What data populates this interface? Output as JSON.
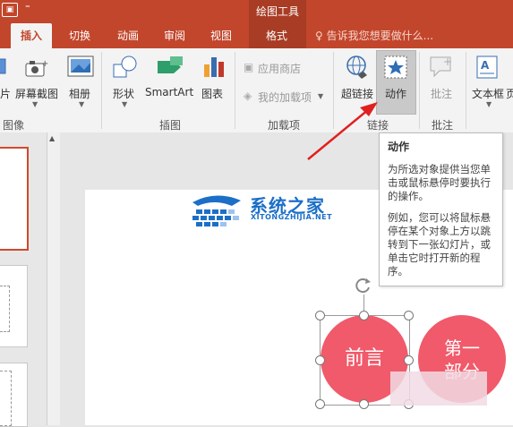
{
  "titlebar": {
    "context_group": "绘图工具"
  },
  "tabs": [
    {
      "label": "插入"
    },
    {
      "label": "切换"
    },
    {
      "label": "动画"
    },
    {
      "label": "审阅"
    },
    {
      "label": "视图"
    },
    {
      "label": "格式"
    }
  ],
  "tellme": {
    "text": "告诉我您想要做什么..."
  },
  "ribbon": {
    "buttons": {
      "picture": "片",
      "screenshot": "屏幕截图",
      "album": "相册",
      "shapes": "形状",
      "smartart": "SmartArt",
      "chart": "图表",
      "store": "应用商店",
      "my_addins": "我的加载项",
      "hyperlink": "超链接",
      "action": "动作",
      "comment": "批注",
      "textbox": "文本框",
      "more": "页"
    },
    "groups": {
      "images": "图像",
      "illustrations": "插图",
      "addins": "加载项",
      "links": "链接",
      "comments": "批注"
    }
  },
  "tooltip": {
    "title": "动作",
    "p1": "为所选对象提供当您单击或鼠标悬停时要执行的操作。",
    "p2": "例如，您可以将鼠标悬停在某个对象上方以跳转到下一张幻灯片，或单击它时打开新的程序。"
  },
  "slide": {
    "circle1": "前言",
    "circle2_line1": "第一",
    "circle2_line2": "部分"
  },
  "watermark": {
    "title": "系统之家",
    "url": "XITONGZHIJIA.NET"
  },
  "colors": {
    "accent": "#c2462c",
    "context": "#a83c24",
    "shape_fill": "#f05a6a",
    "watermark": "#1c6fc7",
    "arrow": "#e02020"
  }
}
